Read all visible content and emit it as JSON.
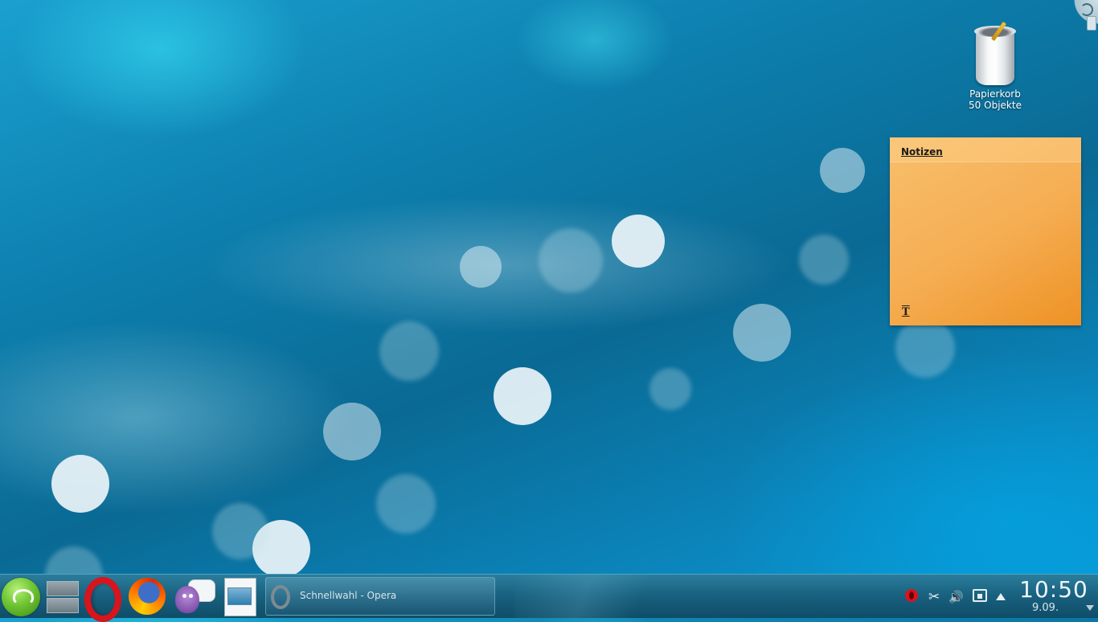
{
  "desktop": {
    "trash": {
      "name": "Papierkorb",
      "count": "50 Objekte"
    },
    "note": {
      "title": "Notizen",
      "format_glyph": "T"
    }
  },
  "taskbar": {
    "launchers": [
      {
        "icon": "opensuse-launcher-icon"
      },
      {
        "icon": "desktop-pager-icon"
      },
      {
        "icon": "opera-icon"
      },
      {
        "icon": "firefox-icon"
      },
      {
        "icon": "pidgin-icon"
      },
      {
        "icon": "document-writer-icon"
      }
    ],
    "task": {
      "label": "Schnellwahl - Opera",
      "icon": "opera-icon"
    },
    "tray": {
      "icons": [
        "opera-tray-icon",
        "scissors-icon",
        "volume-icon",
        "network-icon",
        "expand-tray-icon"
      ],
      "scissors_glyph": "✂",
      "volume_glyph": "🔊"
    },
    "clock": {
      "time": "10:50",
      "date": "9.09."
    }
  },
  "colors": {
    "note_bg": "#f5ad52",
    "opera_red": "#d8141d",
    "panel": "#18607e"
  }
}
